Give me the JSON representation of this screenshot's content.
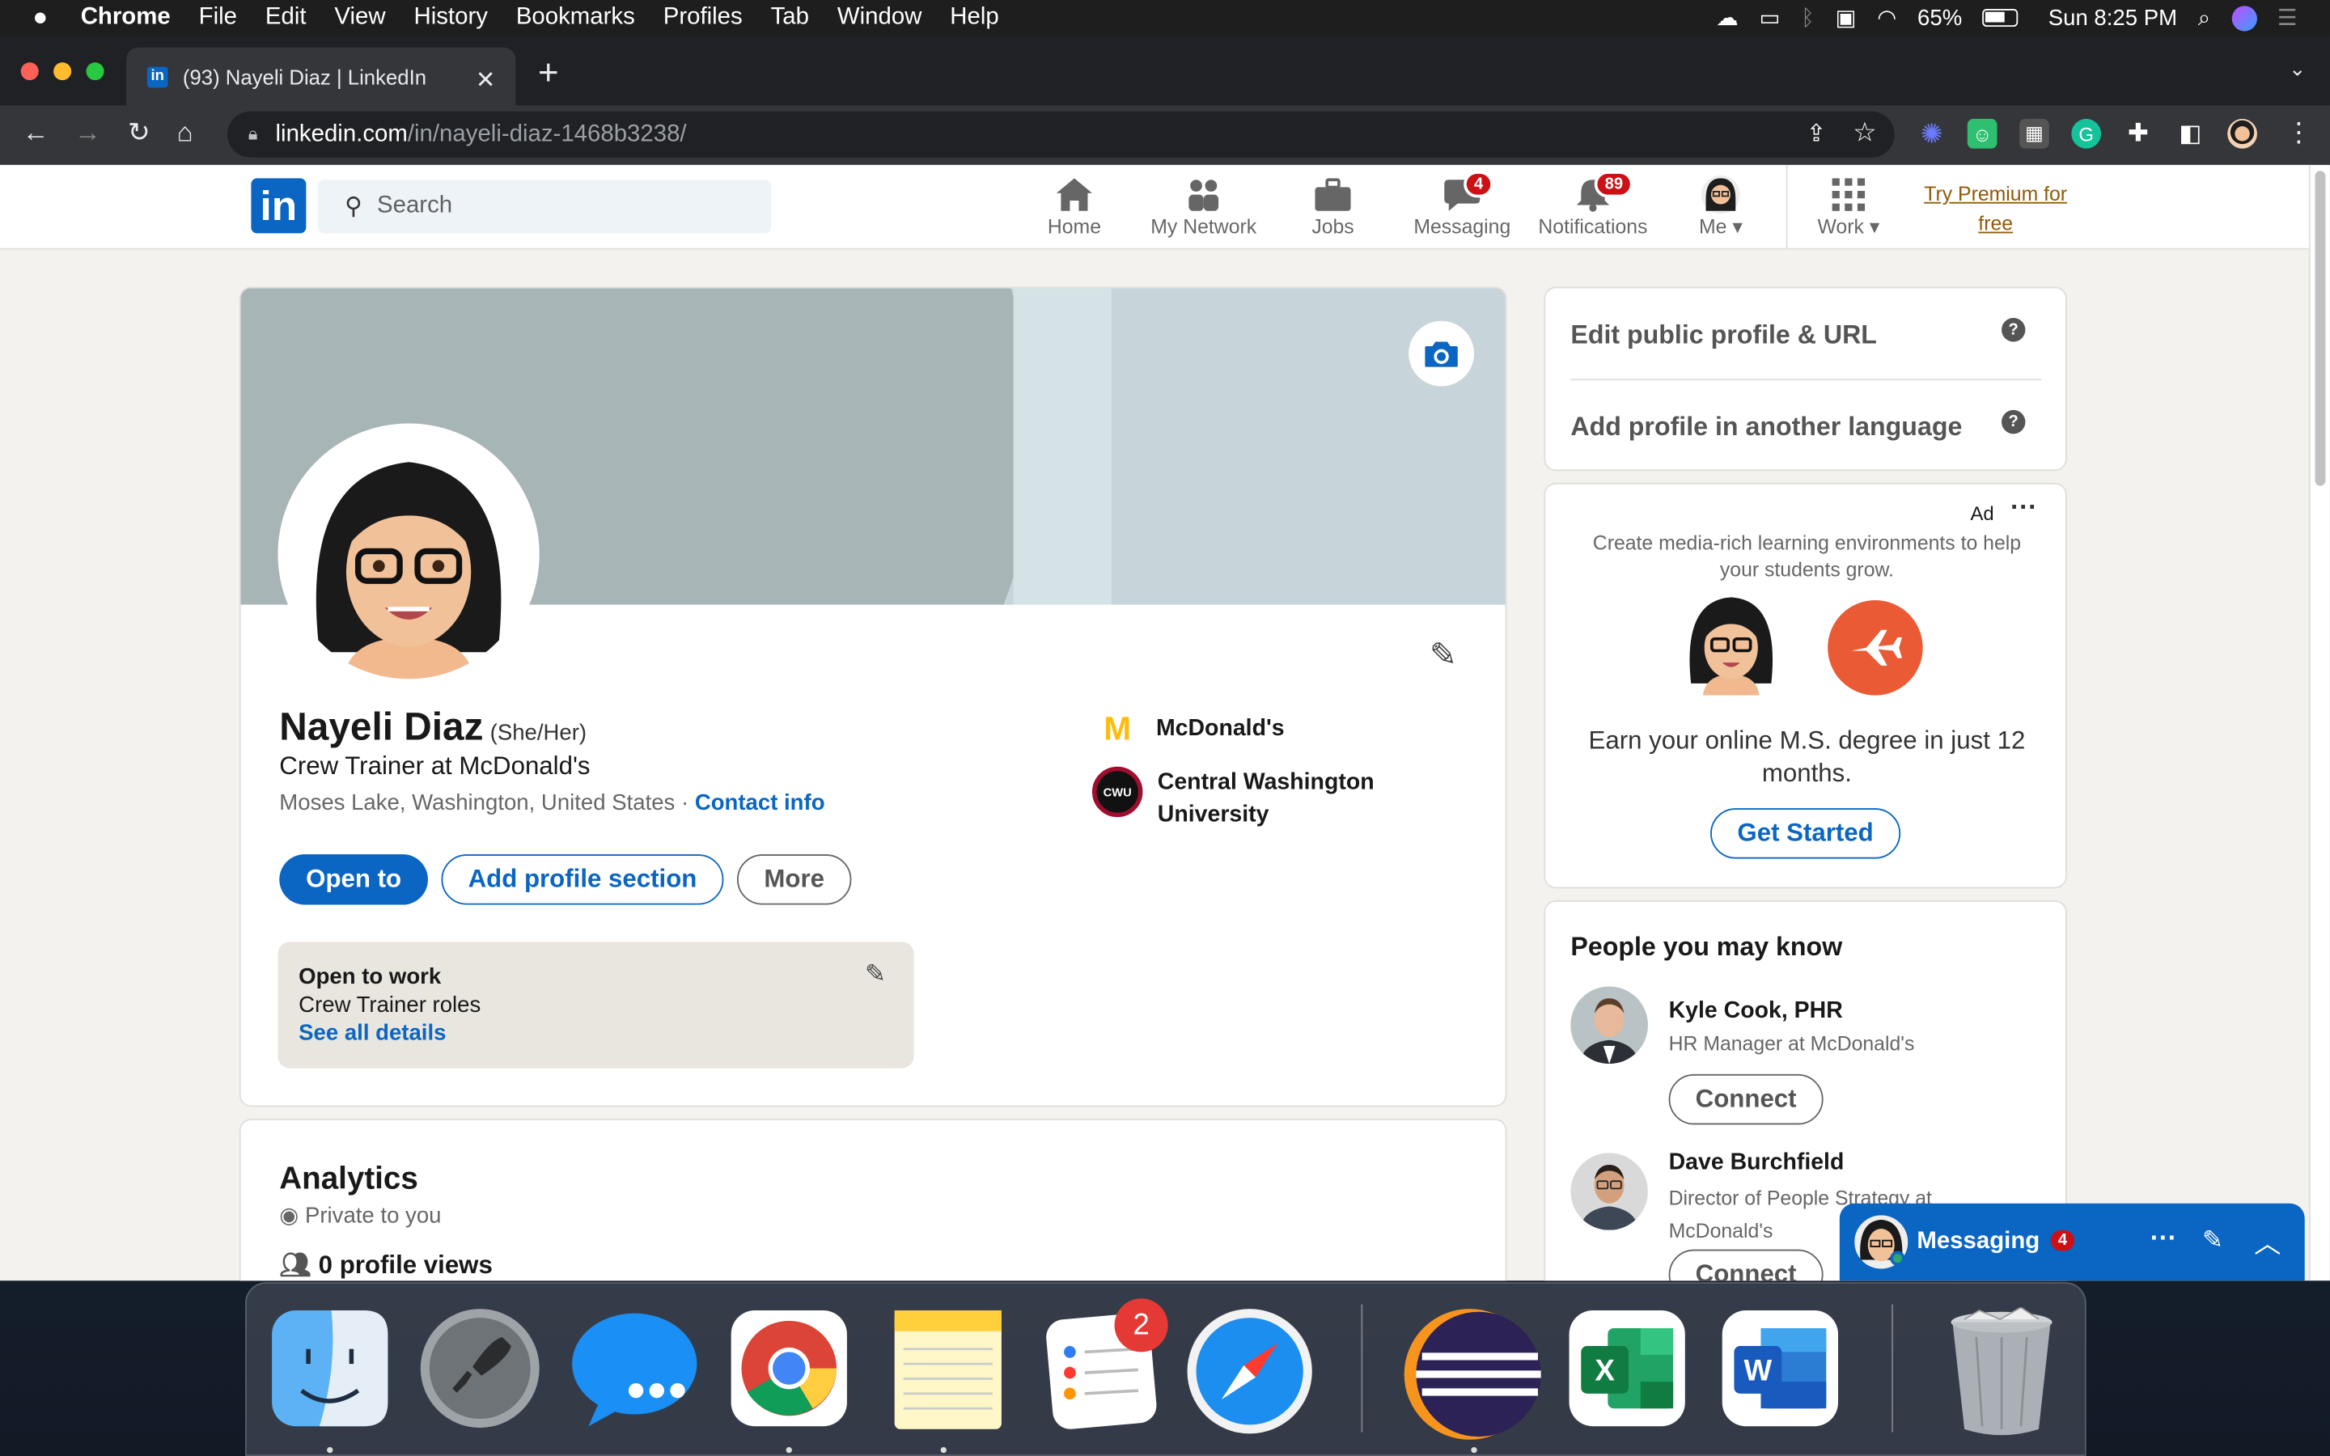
{
  "menubar": {
    "app": "Chrome",
    "items": [
      "File",
      "Edit",
      "View",
      "History",
      "Bookmarks",
      "Profiles",
      "Tab",
      "Window",
      "Help"
    ],
    "battery": "65%",
    "clock": "Sun 8:25 PM"
  },
  "browser": {
    "tab_title": "(93) Nayeli Diaz | LinkedIn",
    "url_host": "linkedin.com",
    "url_path": "/in/nayeli-diaz-1468b3238/"
  },
  "linkedin": {
    "search_placeholder": "Search",
    "nav": [
      {
        "label": "Home"
      },
      {
        "label": "My Network"
      },
      {
        "label": "Jobs"
      },
      {
        "label": "Messaging",
        "badge": "4"
      },
      {
        "label": "Notifications",
        "badge": "89"
      },
      {
        "label": "Me"
      },
      {
        "label": "Work"
      }
    ],
    "premium": "Try Premium for free"
  },
  "profile": {
    "name": "Nayeli Diaz",
    "pronouns": "(She/Her)",
    "headline": "Crew Trainer at McDonald's",
    "location": "Moses Lake, Washington, United States",
    "separator": "·",
    "contact": "Contact info",
    "company": "McDonald's",
    "school": "Central Washington University",
    "school_logo": "CWU",
    "btn_open": "Open to",
    "btn_add": "Add profile section",
    "btn_more": "More",
    "otw_title": "Open to work",
    "otw_roles": "Crew Trainer roles",
    "otw_link": "See all details"
  },
  "analytics": {
    "title": "Analytics",
    "private": "Private to you",
    "views": "0 profile views"
  },
  "sidebar": {
    "edit_url": "Edit public profile & URL",
    "add_lang": "Add profile in another language",
    "ad_label": "Ad",
    "ad_text": "Create media-rich learning environments to help your students grow.",
    "ad_headline": "Earn your online M.S. degree in just 12 months.",
    "ad_cta": "Get Started",
    "pymk_title": "People you may know",
    "people": [
      {
        "name": "Kyle Cook, PHR",
        "title": "HR Manager at McDonald's",
        "action": "Connect"
      },
      {
        "name": "Dave Burchfield",
        "title": "Director of People Strategy at McDonald's",
        "action": "Connect"
      }
    ]
  },
  "messaging": {
    "label": "Messaging",
    "badge": "4"
  },
  "dock": {
    "reminders_badge": "2"
  }
}
